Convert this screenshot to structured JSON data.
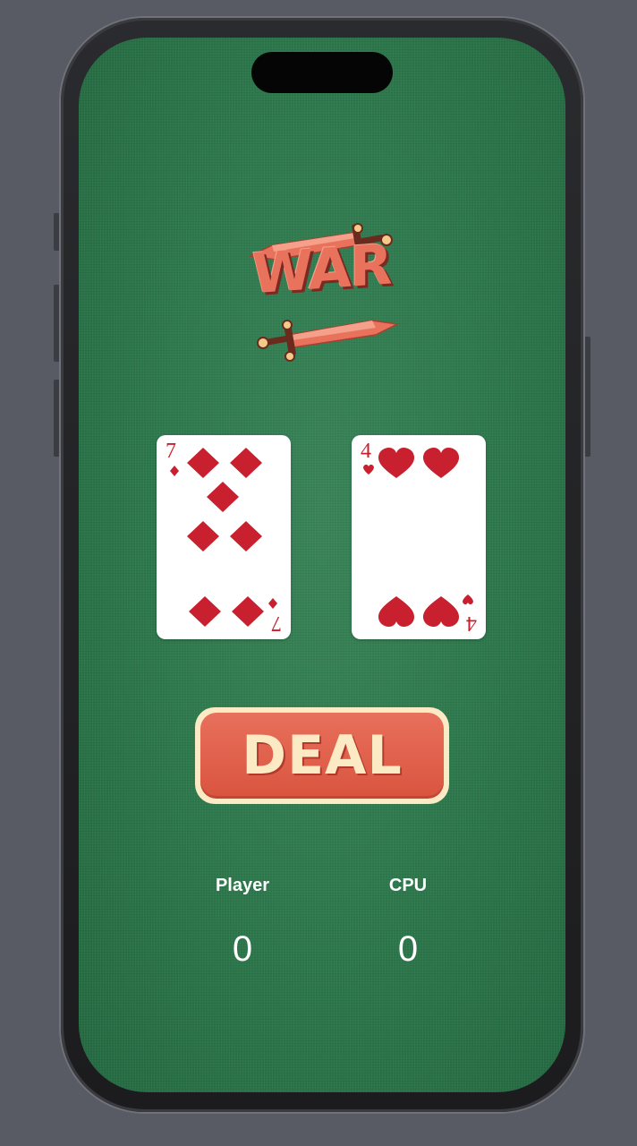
{
  "app": {
    "logo_text": "WAR"
  },
  "cards": {
    "player": {
      "rank": "7",
      "suit": "diamonds",
      "suit_icon": "diamond-icon",
      "color": "#c8202e"
    },
    "cpu": {
      "rank": "4",
      "suit": "hearts",
      "suit_icon": "heart-icon",
      "color": "#c8202e"
    }
  },
  "controls": {
    "deal_label": "DEAL"
  },
  "scores": {
    "player_label": "Player",
    "player_value": "0",
    "cpu_label": "CPU",
    "cpu_value": "0"
  },
  "colors": {
    "felt": "#2f7a4e",
    "accent": "#e8705c",
    "cream": "#fbeac3"
  }
}
